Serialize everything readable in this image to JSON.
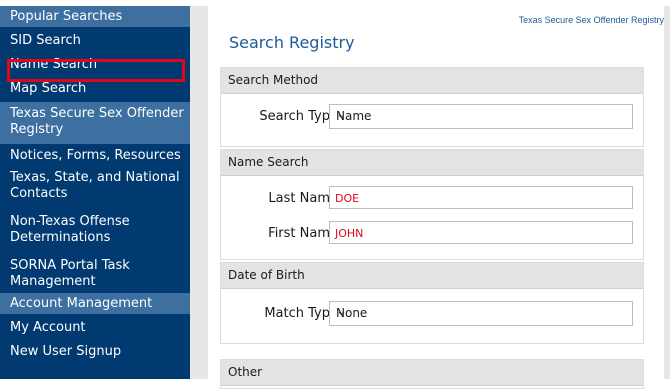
{
  "sidebar": {
    "items": [
      {
        "label": "Popular Searches",
        "type": "heading"
      },
      {
        "label": "SID Search",
        "type": "link"
      },
      {
        "label": "Name Search",
        "type": "link",
        "highlighted": true
      },
      {
        "label": "Map Search",
        "type": "link"
      },
      {
        "label": "Texas Secure Sex Offender Registry",
        "type": "heading"
      },
      {
        "label": "Notices, Forms, Resources",
        "type": "link"
      },
      {
        "label": "Texas, State, and National Contacts",
        "type": "link"
      },
      {
        "label": "Non-Texas Offense Determinations",
        "type": "link"
      },
      {
        "label": "SORNA Portal Task Management",
        "type": "link"
      },
      {
        "label": "Account Management",
        "type": "heading"
      },
      {
        "label": "My Account",
        "type": "link"
      },
      {
        "label": "New User Signup",
        "type": "link"
      }
    ]
  },
  "header": {
    "site_title": "Texas Secure Sex Offender Registry",
    "page_title": "Search Registry"
  },
  "search_method": {
    "heading": "Search Method",
    "search_type_label": "Search Type",
    "search_type_value": "Name"
  },
  "name_search": {
    "heading": "Name Search",
    "last_name_label": "Last Name",
    "last_name_value": "DOE",
    "first_name_label": "First Name",
    "first_name_value": "JOHN"
  },
  "date_of_birth": {
    "heading": "Date of Birth",
    "match_type_label": "Match Type",
    "match_type_value": "None"
  },
  "other": {
    "heading": "Other"
  },
  "colors": {
    "sidebar_bg": "#003a70",
    "sidebar_heading_bg": "#3d6fa0",
    "highlight": "#e3061b",
    "link_blue": "#1d5b9a"
  },
  "icons": {
    "dropdown": "chevron-down-icon"
  }
}
